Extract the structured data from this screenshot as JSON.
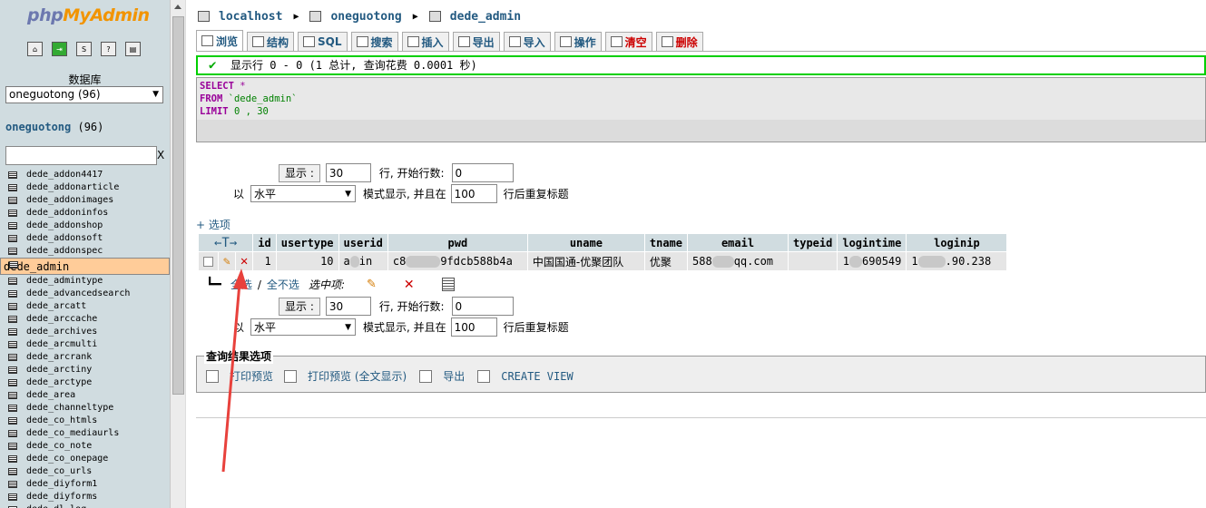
{
  "left": {
    "logo_part1": "php",
    "logo_part2": "MyAdmin",
    "icons": [
      "home-icon",
      "exit-icon",
      "sql-icon",
      "help-icon",
      "docs-icon"
    ],
    "db_label": "数据库",
    "db_select": "oneguotong (96)",
    "db_name": "oneguotong",
    "db_count": "(96)",
    "filter_clear": "X",
    "tables": [
      "dede_addon4417",
      "dede_addonarticle",
      "dede_addonimages",
      "dede_addoninfos",
      "dede_addonshop",
      "dede_addonsoft",
      "dede_addonspec",
      "dede_admin",
      "dede_admintype",
      "dede_advancedsearch",
      "dede_arcatt",
      "dede_arccache",
      "dede_archives",
      "dede_arcmulti",
      "dede_arcrank",
      "dede_arctiny",
      "dede_arctype",
      "dede_area",
      "dede_channeltype",
      "dede_co_htmls",
      "dede_co_mediaurls",
      "dede_co_note",
      "dede_co_onepage",
      "dede_co_urls",
      "dede_diyform1",
      "dede_diyforms",
      "dede_dl_log"
    ],
    "selected_table": "dede_admin"
  },
  "breadcrumb": {
    "server": "localhost",
    "database": "oneguotong",
    "table": "dede_admin"
  },
  "tabs": [
    {
      "label": "浏览",
      "icon": "browse-icon",
      "name": "tab-browse"
    },
    {
      "label": "结构",
      "icon": "structure-icon",
      "name": "tab-structure"
    },
    {
      "label": "SQL",
      "icon": "sql-icon",
      "name": "tab-sql"
    },
    {
      "label": "搜索",
      "icon": "search-icon",
      "name": "tab-search"
    },
    {
      "label": "插入",
      "icon": "insert-icon",
      "name": "tab-insert"
    },
    {
      "label": "导出",
      "icon": "export-icon",
      "name": "tab-export"
    },
    {
      "label": "导入",
      "icon": "import-icon",
      "name": "tab-import"
    },
    {
      "label": "操作",
      "icon": "operations-icon",
      "name": "tab-operations"
    },
    {
      "label": "清空",
      "icon": "empty-icon",
      "name": "tab-empty"
    },
    {
      "label": "删除",
      "icon": "drop-icon",
      "name": "tab-drop"
    }
  ],
  "success_msg": "显示行 0 - 0 (1 总计, 查询花费 0.0001 秒)",
  "sql": {
    "kw_select": "SELECT",
    "star": "*",
    "kw_from": "FROM",
    "table": "`dede_admin`",
    "kw_limit": "LIMIT",
    "limit_vals": "0 , 30"
  },
  "nav": {
    "show_btn": "显示 :",
    "rows": "30",
    "rows_label": "行, 开始行数:",
    "start": "0",
    "prefix": "以",
    "mode": "水平",
    "mode_label": "模式显示, 并且在",
    "repeat": "100",
    "repeat_label": "行后重复标题"
  },
  "options_link": "+ 选项",
  "table": {
    "headers": [
      "id",
      "usertype",
      "userid",
      "pwd",
      "uname",
      "tname",
      "email",
      "typeid",
      "logintime",
      "loginip"
    ],
    "sort_arrows": "←T→",
    "row": {
      "id": "1",
      "usertype": "10",
      "userid_a": "a",
      "userid_b": "in",
      "pwd_a": "c8",
      "pwd_b": "9fdcb588b4a",
      "uname": "中国国通-优聚团队",
      "tname": "优聚",
      "email_a": "588",
      "email_b": "qq.com",
      "typeid": "",
      "logintime_a": "1",
      "logintime_b": "690549",
      "loginip_a": "1",
      "loginip_b": ".90.238"
    }
  },
  "selection": {
    "select_all": "全选",
    "sep": "/",
    "deselect_all": "全不选",
    "with_selected": "选中项:"
  },
  "result_ops": {
    "legend": "查询结果选项",
    "print_view": "打印预览",
    "print_view_full": "打印预览 (全文显示)",
    "export": "导出",
    "create_view": "CREATE VIEW"
  },
  "colors": {
    "link": "#235a81",
    "left_bg": "#d0dce0",
    "success_border": "#00d000",
    "selected_row": "#ffcc99",
    "annotation_arrow": "#e8413c"
  }
}
